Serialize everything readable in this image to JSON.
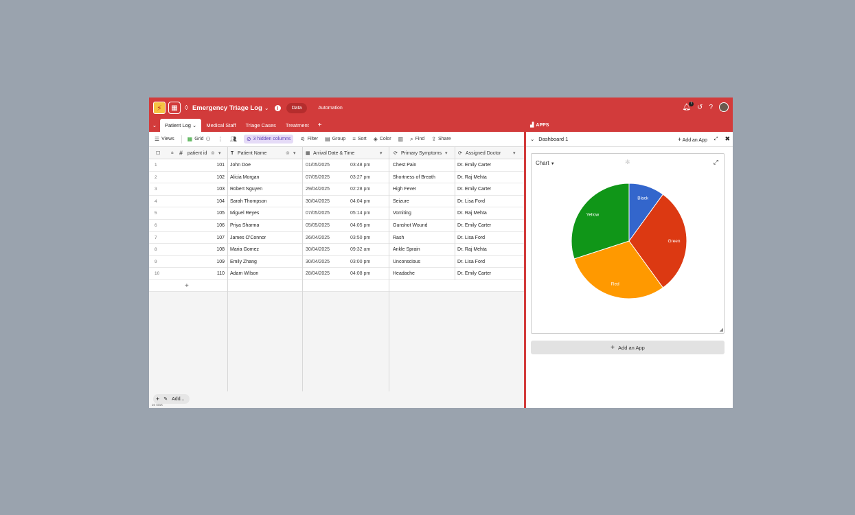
{
  "header": {
    "base_title": "Emergency Triage Log",
    "modes": [
      "Data",
      "Automation"
    ],
    "notification_count": "7"
  },
  "tabs": [
    "Patient Log",
    "Medical Staff",
    "Triage Cases",
    "Treatment"
  ],
  "toolbar": {
    "views": "Views",
    "grid": "Grid",
    "hidden_columns": "3 hidden columns",
    "filter": "Filter",
    "group": "Group",
    "sort": "Sort",
    "color": "Color",
    "find": "Find",
    "share": "Share"
  },
  "columns": {
    "patient_id": "patient id",
    "patient_name": "Patient Name",
    "arrival": "Arrival Date & Time",
    "symptoms": "Primary Symptoms",
    "doctor": "Assigned Doctor"
  },
  "rows": [
    {
      "n": "1",
      "id": "101",
      "name": "John Doe",
      "date": "01/05/2025",
      "time": "03:48 pm",
      "symptom": "Chest Pain",
      "doctor": "Dr. Emily Carter"
    },
    {
      "n": "2",
      "id": "102",
      "name": "Alicia Morgan",
      "date": "07/05/2025",
      "time": "03:27 pm",
      "symptom": "Shortness of Breath",
      "doctor": "Dr. Raj Mehta"
    },
    {
      "n": "3",
      "id": "103",
      "name": "Robert Nguyen",
      "date": "29/04/2025",
      "time": "02:28 pm",
      "symptom": "High Fever",
      "doctor": "Dr. Emily Carter"
    },
    {
      "n": "4",
      "id": "104",
      "name": "Sarah Thompson",
      "date": "30/04/2025",
      "time": "04:04 pm",
      "symptom": "Seizure",
      "doctor": "Dr. Lisa Ford"
    },
    {
      "n": "5",
      "id": "105",
      "name": "Miguel Reyes",
      "date": "07/05/2025",
      "time": "05:14 pm",
      "symptom": "Vomiting",
      "doctor": "Dr. Raj Mehta"
    },
    {
      "n": "6",
      "id": "106",
      "name": "Priya Sharma",
      "date": "05/05/2025",
      "time": "04:05 pm",
      "symptom": "Gunshot Wound",
      "doctor": "Dr. Emily Carter"
    },
    {
      "n": "7",
      "id": "107",
      "name": "James O'Connor",
      "date": "26/04/2025",
      "time": "03:50 pm",
      "symptom": "Rash",
      "doctor": "Dr. Lisa Ford"
    },
    {
      "n": "8",
      "id": "108",
      "name": "Maria Gomez",
      "date": "30/04/2025",
      "time": "09:32 am",
      "symptom": "Ankle Sprain",
      "doctor": "Dr. Raj Mehta"
    },
    {
      "n": "9",
      "id": "109",
      "name": "Emily Zhang",
      "date": "30/04/2025",
      "time": "03:00 pm",
      "symptom": "Unconscious",
      "doctor": "Dr. Lisa Ford"
    },
    {
      "n": "10",
      "id": "110",
      "name": "Adam Wilson",
      "date": "28/04/2025",
      "time": "04:08 pm",
      "symptom": "Headache",
      "doctor": "Dr. Emily Carter"
    }
  ],
  "footer": {
    "add": "Add...",
    "rows_count": "10 rows"
  },
  "apps": {
    "title": "APPS",
    "dashboard": "Dashboard 1",
    "add_app": "Add an App",
    "chart_label": "Chart",
    "add_app_big": "Add an App"
  },
  "chart_data": {
    "type": "pie",
    "labels": [
      "Black",
      "Green",
      "Red",
      "Yellow"
    ],
    "values": [
      10,
      30,
      30,
      30
    ],
    "colors": [
      "#3366cc",
      "#dc3912",
      "#ff9900",
      "#109618"
    ]
  }
}
